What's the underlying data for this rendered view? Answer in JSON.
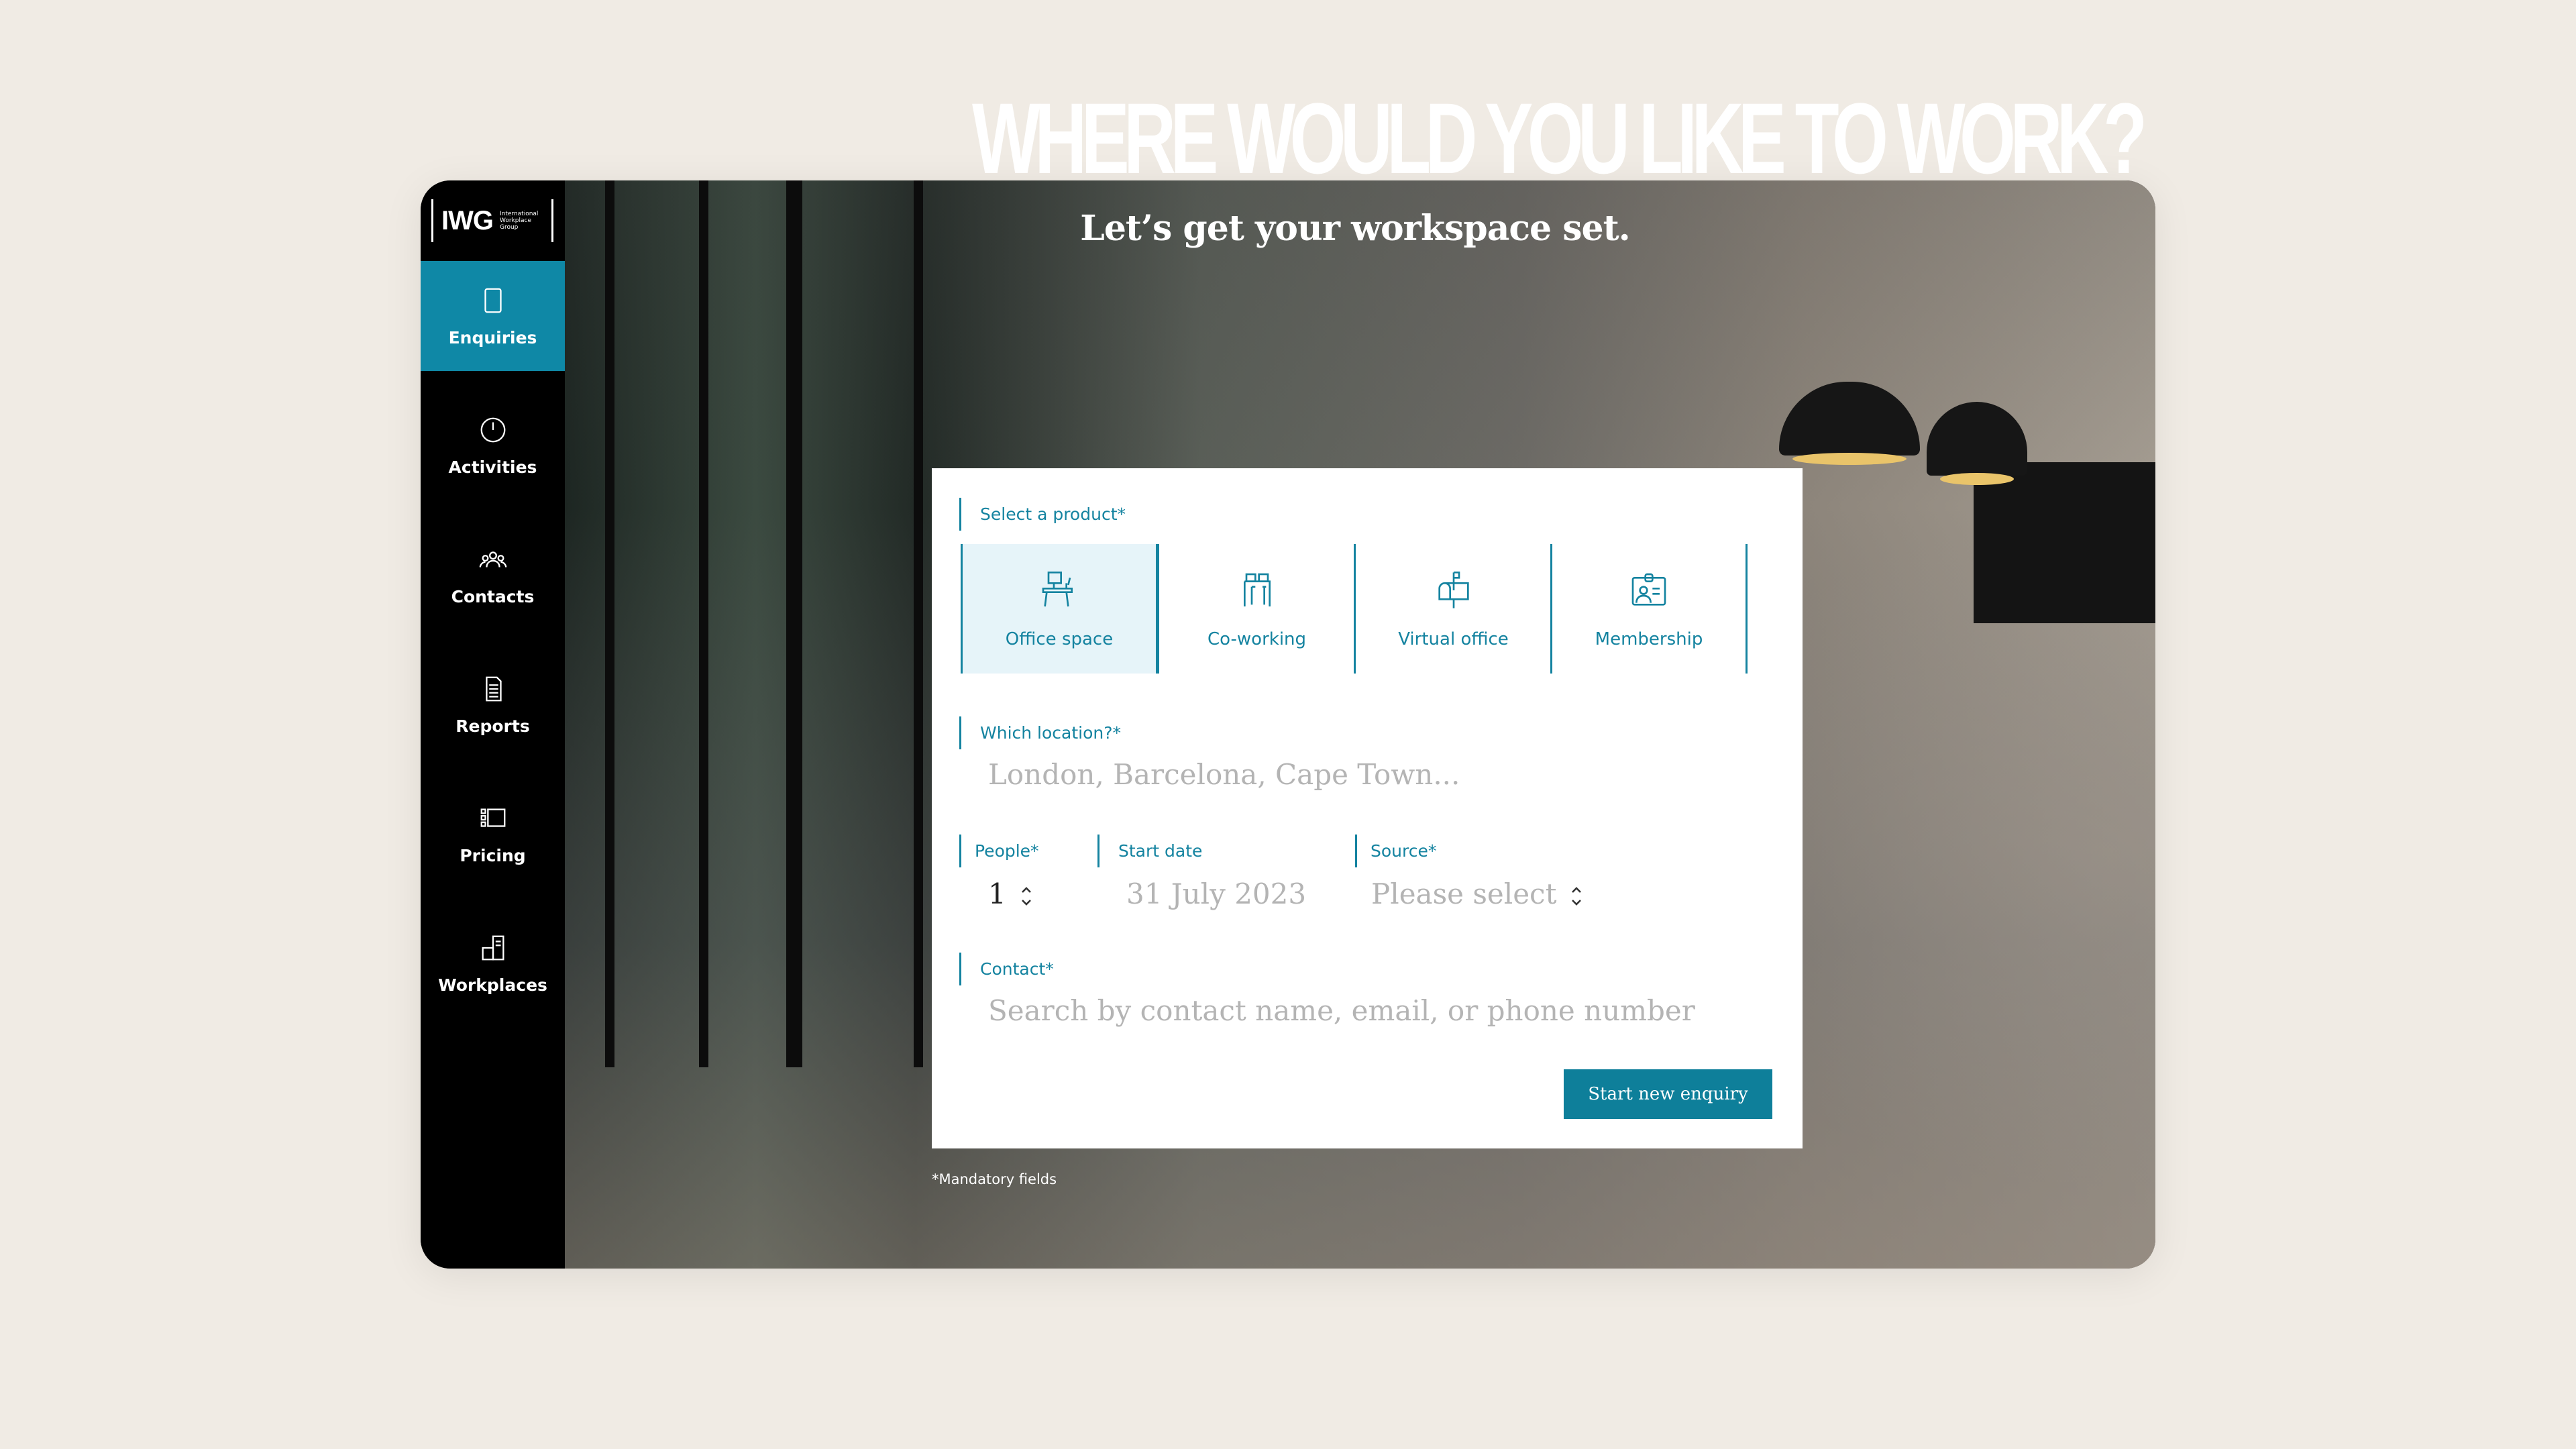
{
  "logo": {
    "mark": "IWG",
    "line1": "International",
    "line2": "Workplace",
    "line3": "Group"
  },
  "sidebar": {
    "items": [
      {
        "label": "Enquiries",
        "icon": "tablet-icon",
        "active": true
      },
      {
        "label": "Activities",
        "icon": "clock-icon"
      },
      {
        "label": "Contacts",
        "icon": "people-icon"
      },
      {
        "label": "Reports",
        "icon": "document-icon"
      },
      {
        "label": "Pricing",
        "icon": "pricing-icon"
      },
      {
        "label": "Workplaces",
        "icon": "buildings-icon"
      }
    ]
  },
  "hero": {
    "title": "WHERE WOULD YOU LIKE TO WORK?",
    "subtitle": "Let’s get your workspace set."
  },
  "form": {
    "product_label": "Select a product*",
    "products": [
      {
        "label": "Office space",
        "selected": true
      },
      {
        "label": "Co-working"
      },
      {
        "label": "Virtual office"
      },
      {
        "label": "Membership"
      }
    ],
    "location_label": "Which location?*",
    "location_placeholder": "London, Barcelona, Cape Town...",
    "people_label": "People*",
    "people_value": "1",
    "start_label": "Start date",
    "start_placeholder": "31 July 2023",
    "source_label": "Source*",
    "source_placeholder": "Please select",
    "contact_label": "Contact*",
    "contact_placeholder": "Search by contact name, email, or phone number",
    "submit": "Start new enquiry"
  },
  "footnote": "*Mandatory fields",
  "colors": {
    "accent": "#0f88a6",
    "button": "#0e7f9a",
    "background": "#f0ebe4"
  }
}
